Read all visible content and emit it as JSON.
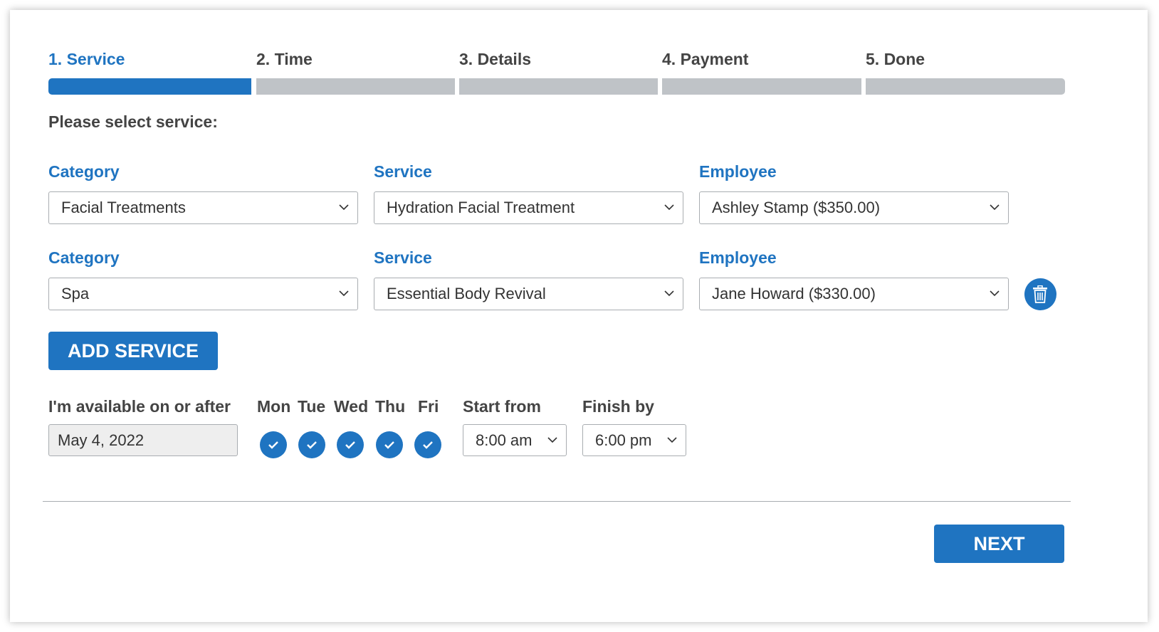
{
  "steps": [
    {
      "label": "1. Service",
      "active": true
    },
    {
      "label": "2. Time",
      "active": false
    },
    {
      "label": "3. Details",
      "active": false
    },
    {
      "label": "4. Payment",
      "active": false
    },
    {
      "label": "5. Done",
      "active": false
    }
  ],
  "prompt": "Please select service:",
  "service_rows": [
    {
      "category_label": "Category",
      "category_value": "Facial Treatments",
      "service_label": "Service",
      "service_value": "Hydration Facial Treatment",
      "employee_label": "Employee",
      "employee_value": "Ashley Stamp ($350.00)"
    },
    {
      "category_label": "Category",
      "category_value": "Spa",
      "service_label": "Service",
      "service_value": "Essential Body Revival",
      "employee_label": "Employee",
      "employee_value": "Jane Howard ($330.00)"
    }
  ],
  "add_service_label": "ADD SERVICE",
  "availability": {
    "date_label": "I'm available on or after",
    "date_value": "May 4, 2022",
    "days": [
      {
        "label": "Mon",
        "checked": true
      },
      {
        "label": "Tue",
        "checked": true
      },
      {
        "label": "Wed",
        "checked": true
      },
      {
        "label": "Thu",
        "checked": true
      },
      {
        "label": "Fri",
        "checked": true
      }
    ],
    "start_label": "Start from",
    "start_value": "8:00 am",
    "finish_label": "Finish by",
    "finish_value": "6:00 pm"
  },
  "next_label": "NEXT",
  "icons": {
    "delete": "trash-icon",
    "check": "check-icon",
    "dropdown": "chevron-down-icon"
  },
  "colors": {
    "accent": "#1f74c1",
    "inactive_bar": "#bfc3c7",
    "text": "#444444"
  }
}
